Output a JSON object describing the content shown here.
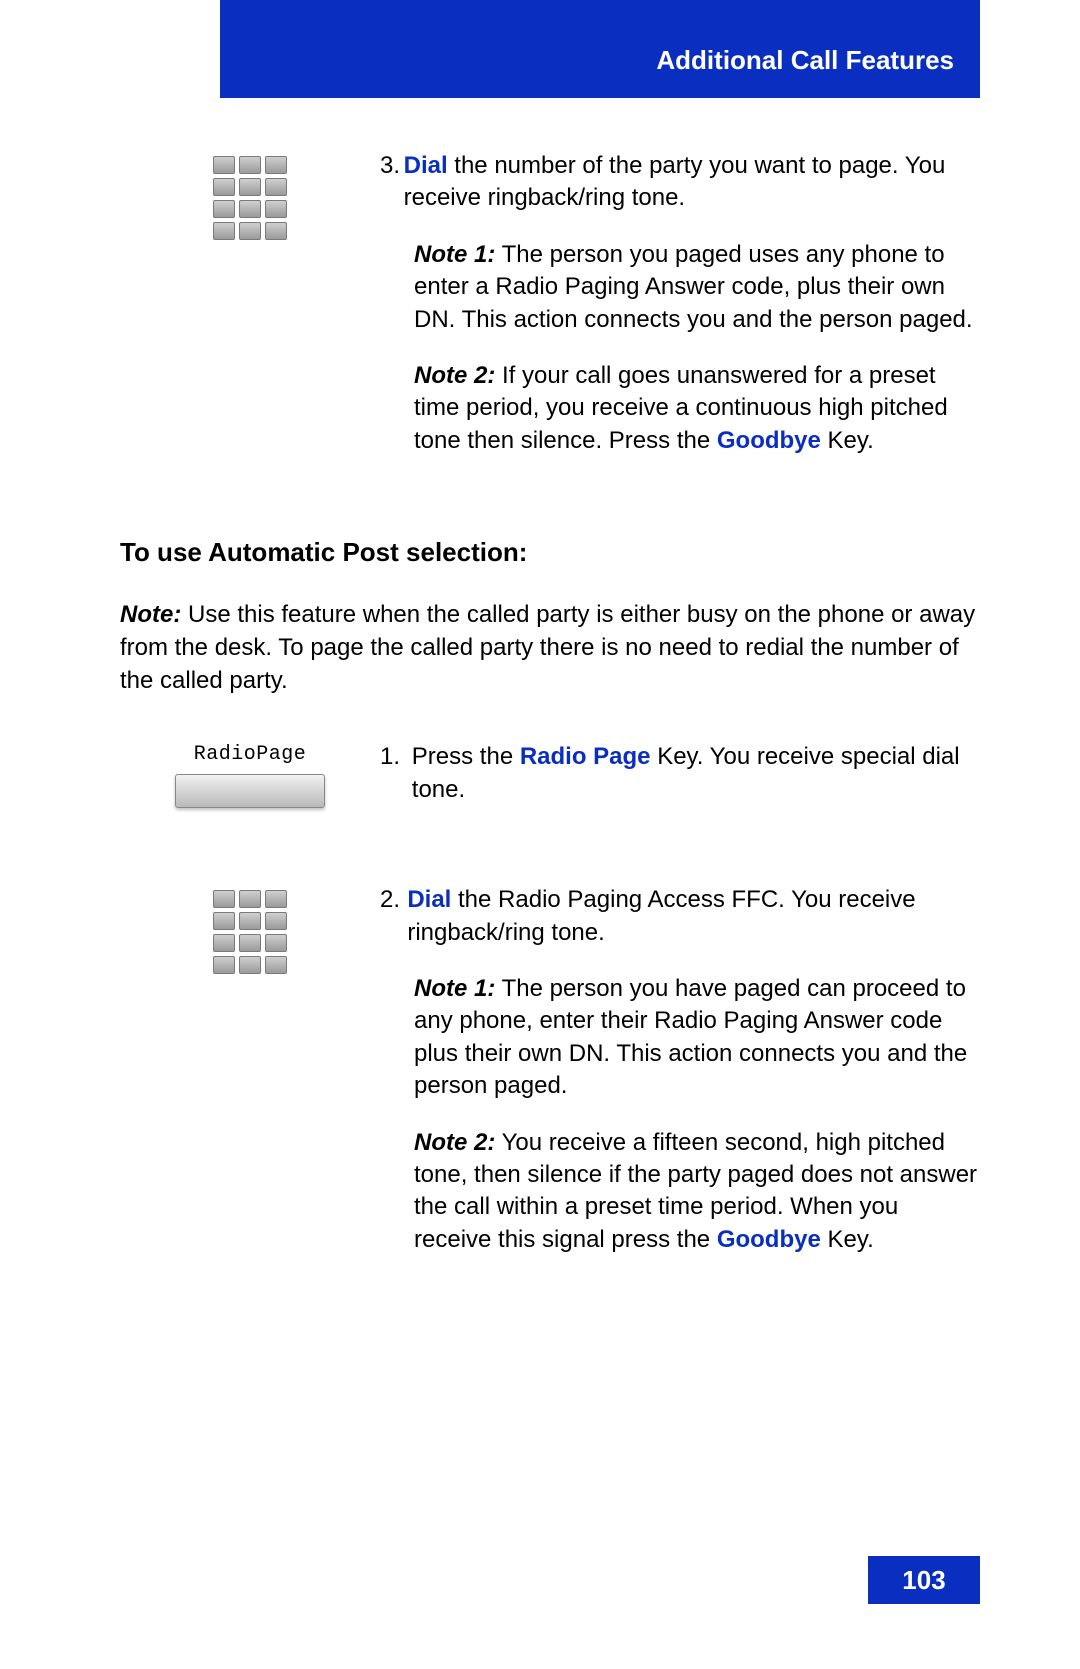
{
  "header": {
    "title": "Additional Call Features"
  },
  "page_number": "103",
  "step3": {
    "num": "3.",
    "lead_key": "Dial",
    "lead_rest": " the number of the party you want to page. You receive ringback/ring tone.",
    "note1_label": "Note 1:",
    "note1_text": " The person you paged uses any phone to enter a Radio Paging Answer code, plus their own DN. This action connects you and the person paged.",
    "note2_label": "Note 2:",
    "note2_text_a": " If your call goes unanswered for a preset time period, you receive a continuous high pitched tone then silence. Press the ",
    "note2_key": "Goodbye",
    "note2_text_b": " Key."
  },
  "auto_post": {
    "heading": "To use Automatic Post selection:",
    "note_label": "Note:",
    "note_text": " Use this feature when the called party is either busy on the phone or away from the desk. To page the called party there is no need to redial the number of the called party."
  },
  "softkey": {
    "label": "RadioPage"
  },
  "step1": {
    "num": "1.",
    "text_a": "Press the ",
    "key": "Radio Page",
    "text_b": " Key. You receive special dial tone."
  },
  "step2": {
    "num": "2.",
    "lead_key": "Dial",
    "lead_rest": " the Radio Paging Access FFC. You receive ringback/ring tone.",
    "note1_label": "Note 1:",
    "note1_text": " The person you have paged can proceed to any phone, enter their Radio Paging Answer code plus their own DN. This action connects you and the person paged.",
    "note2_label": "Note 2:",
    "note2_text_a": " You receive a fifteen second, high pitched tone, then silence if the party paged does not answer the call within a preset time period. When you receive this signal press the ",
    "note2_key": "Goodbye",
    "note2_text_b": " Key."
  }
}
